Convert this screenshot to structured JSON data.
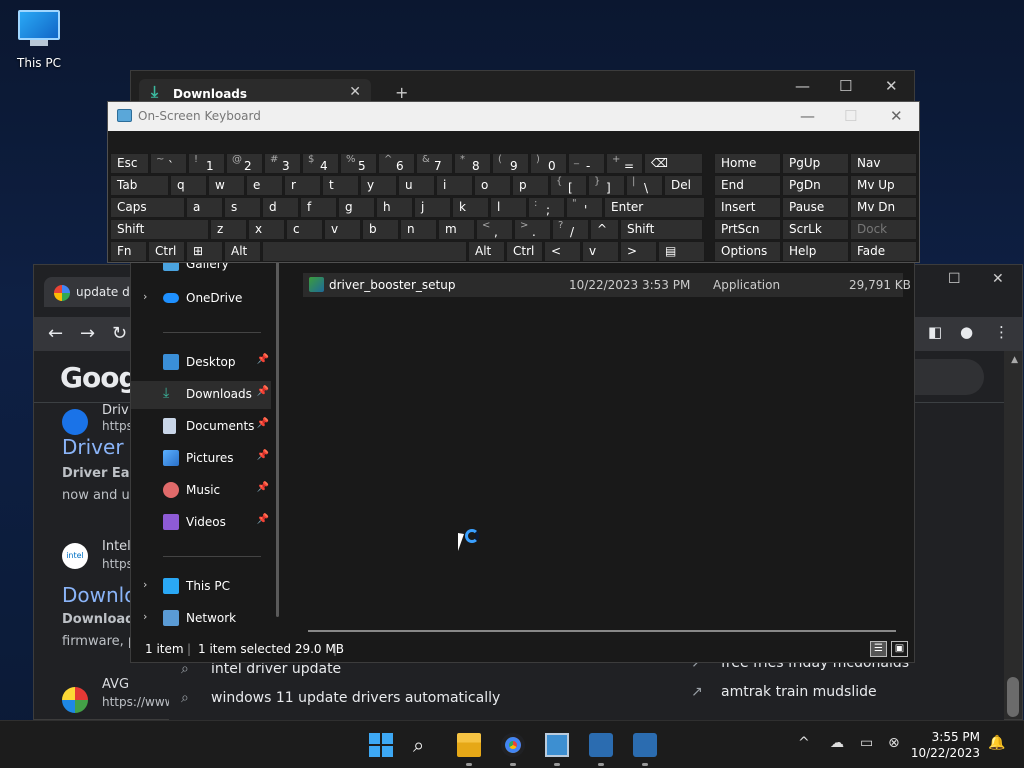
{
  "desktop": {
    "this_pc_label": "This PC"
  },
  "explorer": {
    "tab_title": "Downloads",
    "new_tab": "+",
    "minimize": "—",
    "maximize": "☐",
    "close": "✕",
    "nav": {
      "gallery": "Gallery",
      "onedrive": "OneDrive",
      "desktop": "Desktop",
      "downloads": "Downloads",
      "documents": "Documents",
      "pictures": "Pictures",
      "music": "Music",
      "videos": "Videos",
      "this_pc": "This PC",
      "network": "Network"
    },
    "files": [
      {
        "name": "driver_booster_setup",
        "modified": "10/22/2023 3:53 PM",
        "type": "Application",
        "size": "29,791 KB"
      }
    ],
    "status": {
      "count": "1 item",
      "selected": "1 item selected  29.0 MB"
    }
  },
  "chrome": {
    "tab_title": "update dr",
    "google_logo": "Googl",
    "results": [
      {
        "site": "Driv",
        "url": "https",
        "title": "Driver E",
        "snippet1": "Driver Easy",
        "snippet2": "now and up"
      },
      {
        "site": "Intel",
        "url": "https",
        "title": "Downlo",
        "snippet1": "Download d",
        "snippet2": "firmware, p"
      },
      {
        "site": "AVG",
        "url": "https://www"
      }
    ],
    "suggestions": [
      "intel driver update",
      "windows 11 update drivers automatically",
      "free fries friday mcdonalds",
      "amtrak train mudslide"
    ]
  },
  "osk": {
    "title": "On-Screen Keyboard",
    "row1": [
      {
        "l": "Esc"
      },
      {
        "s": "~",
        "m": "`"
      },
      {
        "s": "!",
        "m": "1"
      },
      {
        "s": "@",
        "m": "2"
      },
      {
        "s": "#",
        "m": "3"
      },
      {
        "s": "$",
        "m": "4"
      },
      {
        "s": "%",
        "m": "5"
      },
      {
        "s": "^",
        "m": "6"
      },
      {
        "s": "&",
        "m": "7"
      },
      {
        "s": "*",
        "m": "8"
      },
      {
        "s": "(",
        "m": "9"
      },
      {
        "s": ")",
        "m": "0"
      },
      {
        "s": "_",
        "m": "-"
      },
      {
        "s": "+",
        "m": "="
      },
      {
        "l": "⌫"
      }
    ],
    "row2": [
      {
        "l": "Tab"
      },
      {
        "l": "q"
      },
      {
        "l": "w"
      },
      {
        "l": "e"
      },
      {
        "l": "r"
      },
      {
        "l": "t"
      },
      {
        "l": "y"
      },
      {
        "l": "u"
      },
      {
        "l": "i"
      },
      {
        "l": "o"
      },
      {
        "l": "p"
      },
      {
        "s": "{",
        "m": "["
      },
      {
        "s": "}",
        "m": "]"
      },
      {
        "s": "|",
        "m": "\\"
      },
      {
        "l": "Del"
      }
    ],
    "row3": [
      {
        "l": "Caps"
      },
      {
        "l": "a"
      },
      {
        "l": "s"
      },
      {
        "l": "d"
      },
      {
        "l": "f"
      },
      {
        "l": "g"
      },
      {
        "l": "h"
      },
      {
        "l": "j"
      },
      {
        "l": "k"
      },
      {
        "l": "l"
      },
      {
        "s": ":",
        "m": ";"
      },
      {
        "s": "\"",
        "m": "'"
      },
      {
        "l": "Enter"
      }
    ],
    "row4": [
      {
        "l": "Shift"
      },
      {
        "l": "z"
      },
      {
        "l": "x"
      },
      {
        "l": "c"
      },
      {
        "l": "v"
      },
      {
        "l": "b"
      },
      {
        "l": "n"
      },
      {
        "l": "m"
      },
      {
        "s": "<",
        "m": ","
      },
      {
        "s": ">",
        "m": "."
      },
      {
        "s": "?",
        "m": "/"
      },
      {
        "l": "^"
      },
      {
        "l": "Shift"
      }
    ],
    "row5": [
      {
        "l": "Fn"
      },
      {
        "l": "Ctrl"
      },
      {
        "l": "⊞"
      },
      {
        "l": "Alt"
      },
      {
        "l": ""
      },
      {
        "l": "Alt"
      },
      {
        "l": "Ctrl"
      },
      {
        "l": "<"
      },
      {
        "l": "v"
      },
      {
        "l": ">"
      },
      {
        "l": "▤"
      }
    ],
    "nav_keys": [
      [
        "Home",
        "PgUp",
        "Nav"
      ],
      [
        "End",
        "PgDn",
        "Mv Up"
      ],
      [
        "Insert",
        "Pause",
        "Mv Dn"
      ],
      [
        "PrtScn",
        "ScrLk",
        "Dock"
      ],
      [
        "Options",
        "Help",
        "Fade"
      ]
    ]
  },
  "taskbar": {
    "time": "3:55 PM",
    "date": "10/22/2023"
  }
}
